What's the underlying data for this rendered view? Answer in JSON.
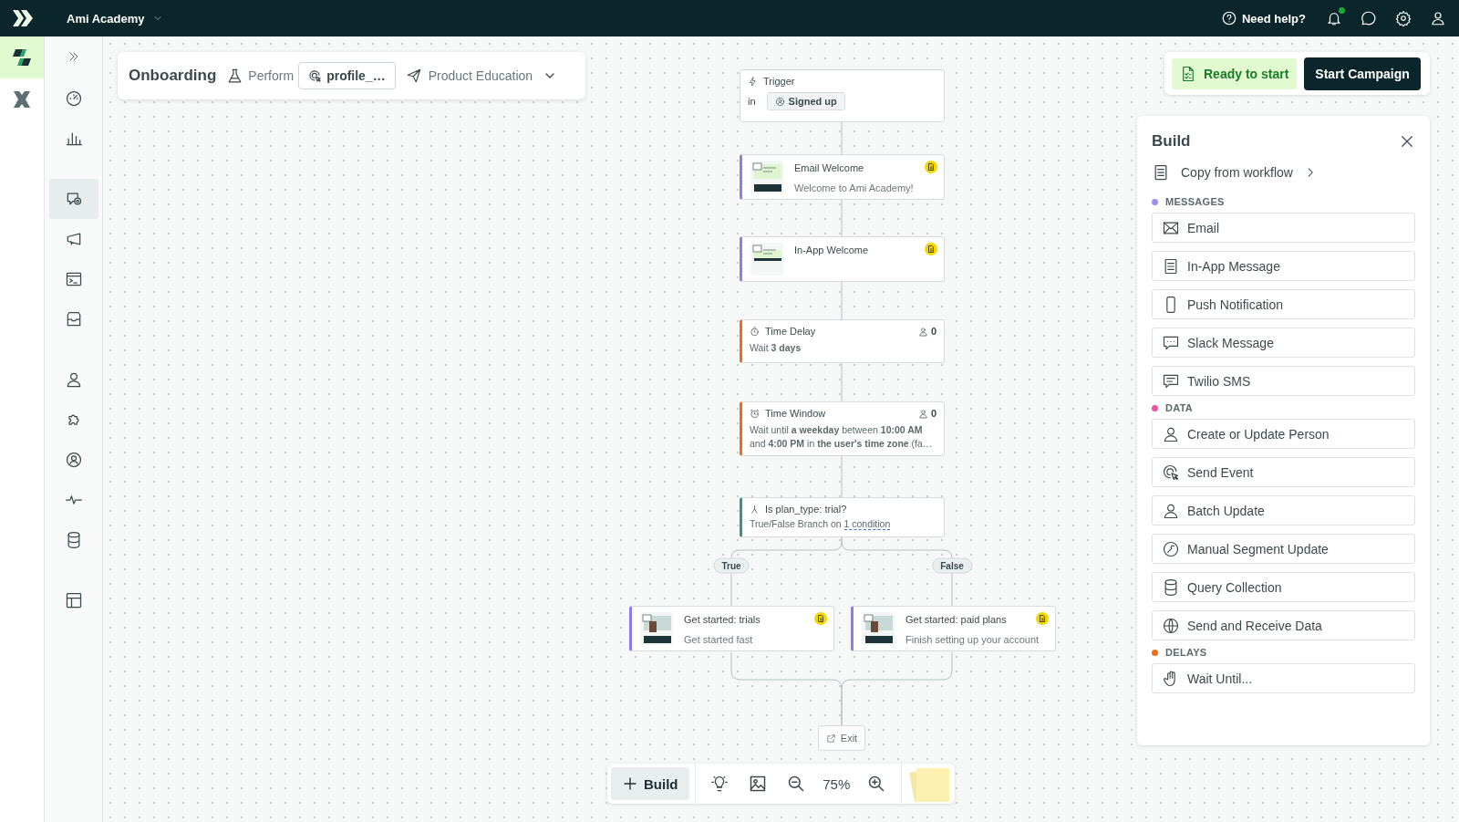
{
  "top_bar": {
    "workspace": "Ami Academy",
    "help": "Need help?",
    "notifications_unread": true
  },
  "apps": [
    {
      "selected": true
    },
    {
      "selected": false
    }
  ],
  "nav_groups": [
    [
      {
        "selected": false
      },
      {
        "selected": false
      }
    ],
    [
      {
        "selected": true
      },
      {
        "selected": false
      },
      {
        "selected": false
      },
      {
        "selected": false
      }
    ],
    [
      {
        "selected": false
      },
      {
        "selected": false
      },
      {
        "selected": false
      },
      {
        "selected": false
      },
      {
        "selected": false
      }
    ],
    [
      {
        "selected": false
      }
    ]
  ],
  "header": {
    "title": "Onboarding",
    "goal": "Perform",
    "event": "profile_…",
    "category": "Product Education"
  },
  "trigger": {
    "label": "Trigger",
    "prefix": "in",
    "event": "Signed up"
  },
  "steps": [
    {
      "kind": "email",
      "title": "Email Welcome",
      "subtitle": "Welcome to Ami Academy!"
    },
    {
      "kind": "in_app",
      "title": "In-App Welcome"
    },
    {
      "kind": "delay",
      "title": "Time Delay",
      "count": "0",
      "lines": [
        "Wait **3 days**"
      ]
    },
    {
      "kind": "window",
      "title": "Time Window",
      "count": "0",
      "lines": [
        "Wait until **a weekday** between **10:00 AM**",
        "and **4:00 PM** in **the user's time zone** (fa…"
      ]
    },
    {
      "kind": "branch",
      "title": "Is plan_type: trial?",
      "text": "True/False Branch on",
      "link": "1 condition"
    }
  ],
  "branches": [
    {
      "label": "True",
      "step": {
        "kind": "email",
        "title": "Get started: trials",
        "subtitle": "Get started fast"
      }
    },
    {
      "label": "False",
      "step": {
        "kind": "email",
        "title": "Get started: paid plans",
        "subtitle": "Finish setting up your account"
      }
    }
  ],
  "exit": "Exit",
  "toolbar": {
    "build": "Build",
    "zoom": "75%"
  },
  "launch": {
    "status": "Ready to start",
    "button": "Start Campaign"
  },
  "build_panel": {
    "title": "Build",
    "copy": "Copy from workflow",
    "sections": [
      {
        "label": "MESSAGES",
        "color": "#9d8df1",
        "items": [
          "Email",
          "In-App Message",
          "Push Notification",
          "Slack Message",
          "Twilio SMS"
        ]
      },
      {
        "label": "DATA",
        "color": "#f0519f",
        "items": [
          "Create or Update Person",
          "Send Event",
          "Batch Update",
          "Manual Segment Update",
          "Query Collection",
          "Send and Receive Data"
        ]
      },
      {
        "label": "DELAYS",
        "color": "#f26a1b",
        "items": [
          "Wait Until..."
        ]
      }
    ]
  }
}
